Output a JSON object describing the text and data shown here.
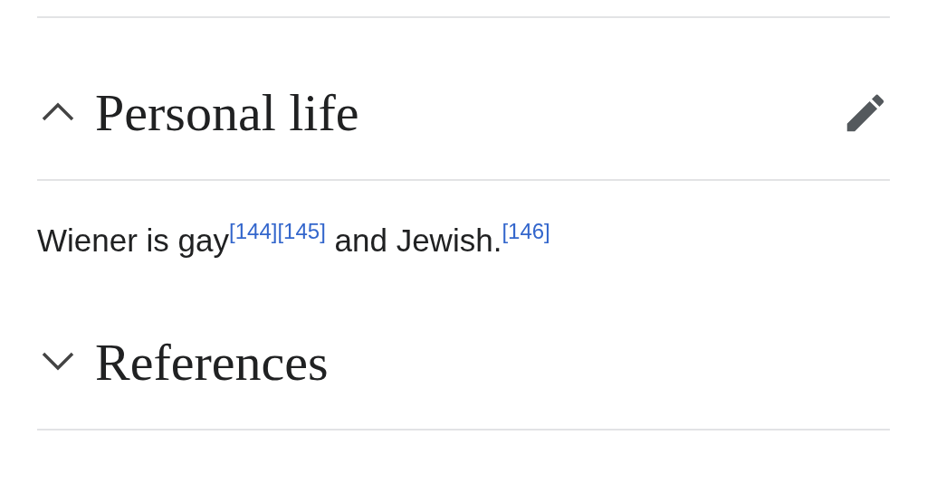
{
  "sections": [
    {
      "title": "Personal life",
      "expanded": true,
      "paragraph": [
        {
          "kind": "text",
          "text": "Wiener is gay"
        },
        {
          "kind": "cite",
          "text": "[144]"
        },
        {
          "kind": "cite",
          "text": "[145]"
        },
        {
          "kind": "text",
          "text": " and Jewish."
        },
        {
          "kind": "cite",
          "text": "[146]"
        }
      ]
    },
    {
      "title": "References",
      "expanded": false
    }
  ]
}
